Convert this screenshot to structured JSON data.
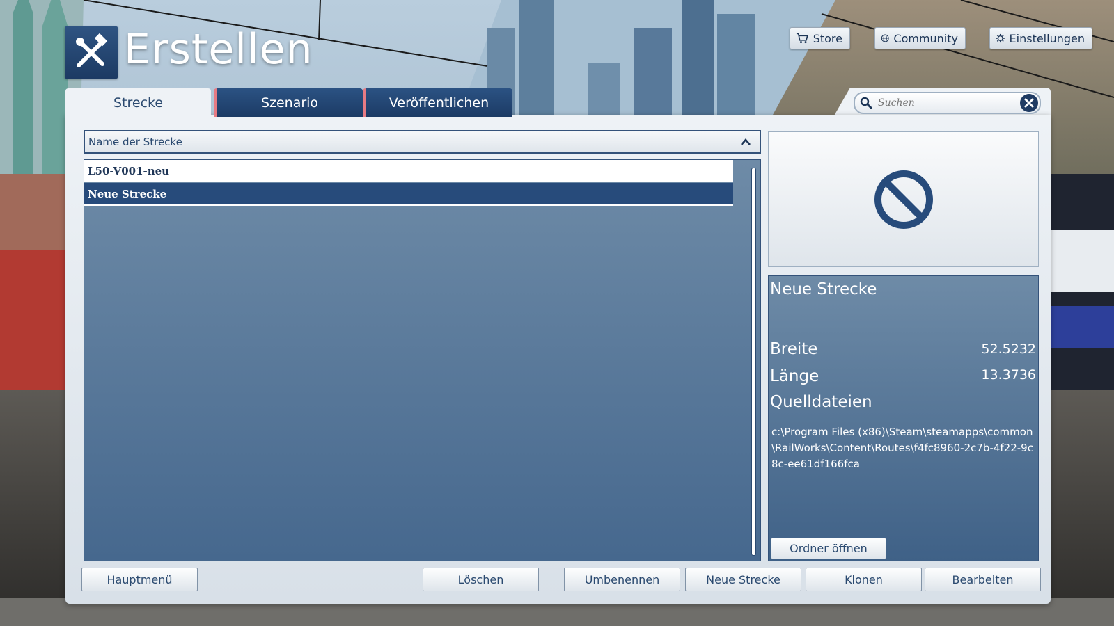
{
  "header": {
    "title": "Erstellen",
    "logo_icon": "tools-hammer-wrench-icon"
  },
  "top_buttons": {
    "store": "Store",
    "community": "Community",
    "settings": "Einstellungen"
  },
  "tabs": [
    {
      "label": "Strecke",
      "active": true
    },
    {
      "label": "Szenario",
      "active": false
    },
    {
      "label": "Veröffentlichen",
      "active": false
    }
  ],
  "search": {
    "placeholder": "Suchen"
  },
  "list": {
    "header": "Name der Strecke",
    "items": [
      {
        "label": "L50-V001-neu",
        "selected": false
      },
      {
        "label": "Neue Strecke",
        "selected": true
      }
    ]
  },
  "preview": {
    "icon": "no-entry-icon"
  },
  "details": {
    "title": "Neue Strecke",
    "breite_label": "Breite",
    "breite_value": "52.5232",
    "laenge_label": "Länge",
    "laenge_value": "13.3736",
    "quelldateien_label": "Quelldateien",
    "path": "c:\\Program Files (x86)\\Steam\\steamapps\\common\\RailWorks\\Content\\Routes\\f4fc8960-2c7b-4f22-9c8c-ee61df166fca",
    "open_folder": "Ordner öffnen"
  },
  "buttons": {
    "main_menu": "Hauptmenü",
    "delete": "Löschen",
    "rename": "Umbenennen",
    "new_route": "Neue Strecke",
    "clone": "Klonen",
    "edit": "Bearbeiten"
  },
  "colors": {
    "accent": "#274b7b",
    "panel": "#eef2f6",
    "list_bg": "#5a7a9c"
  }
}
